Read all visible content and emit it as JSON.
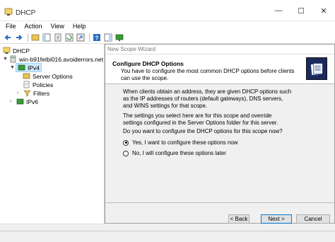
{
  "window": {
    "title": "DHCP",
    "buttons": [
      "—",
      "☐",
      "✕"
    ]
  },
  "menu": [
    "File",
    "Action",
    "View",
    "Help"
  ],
  "toolbar": [
    "back-icon",
    "forward-icon",
    "up-icon",
    "show-tree-icon",
    "properties-icon",
    "refresh-icon",
    "export-icon",
    "help-icon",
    "action-pane-icon",
    "monitor-icon"
  ],
  "tree": {
    "root": "DHCP",
    "server": "win-b91fetbi016.avoiderrors.net",
    "ipv4": "IPv4",
    "server_options": "Server Options",
    "policies": "Policies",
    "filters": "Filters",
    "ipv6": "IPv6"
  },
  "wizard": {
    "title": "New Scope Wizard",
    "heading": "Configure DHCP Options",
    "subheading": "You have to configure the most common DHCP options before clients can use the scope.",
    "para1": "When clients obtain an address, they are given DHCP options such as the IP addresses of routers (default gateways), DNS servers, and WINS settings for that scope.",
    "para2": "The settings you select here are for this scope and override settings configured in the Server Options folder for this server.",
    "question": "Do you want to configure the DHCP options for this scope now?",
    "option_yes": "Yes, I want to configure these options now",
    "option_no": "No, I will configure these options later",
    "selected": "yes",
    "back": "< Back",
    "next": "Next >",
    "cancel": "Cancel"
  },
  "colors": {
    "selection": "#cce8ff",
    "accent": "#0078d7",
    "logo": "#1b2a5e"
  }
}
